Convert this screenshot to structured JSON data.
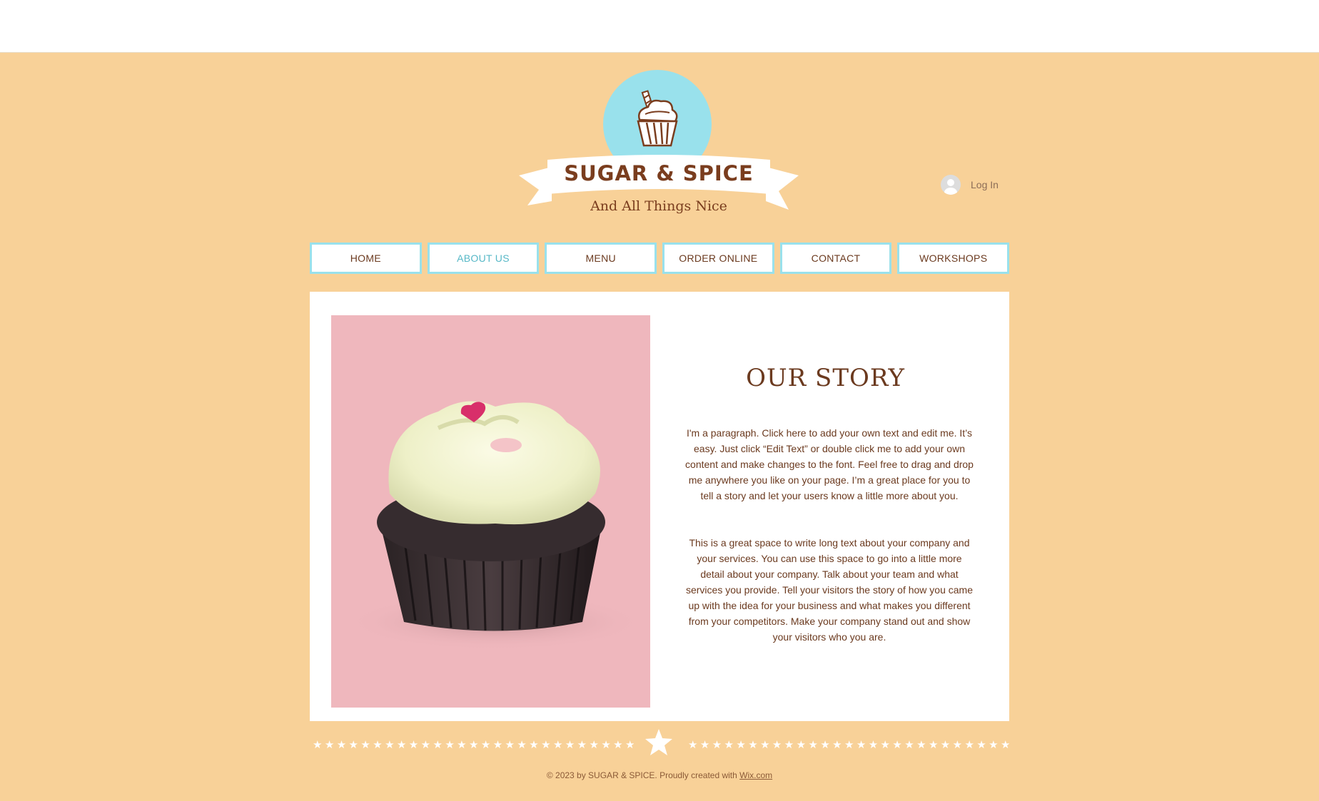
{
  "header": {
    "brand_name": "SUGAR & SPICE",
    "tagline": "And All Things Nice",
    "login_label": "Log In",
    "logo_icon": "cupcake-icon"
  },
  "nav": {
    "items": [
      {
        "label": "HOME"
      },
      {
        "label": "ABOUT US",
        "active": true
      },
      {
        "label": "MENU"
      },
      {
        "label": "ORDER ONLINE"
      },
      {
        "label": "CONTACT"
      },
      {
        "label": "WORKSHOPS"
      }
    ]
  },
  "story": {
    "title": "OUR STORY",
    "paragraph1": "I'm a paragraph. Click here to add your own text and edit me. It’s easy. Just click “Edit Text” or double click me to add your own content and make changes to the font. Feel free to drag and drop me anywhere you like on your page. I’m a great place for you to tell a story and let your users know a little more about you.",
    "paragraph2": "This is a great space to write long text about your company and your services. You can use this space to go into a little more detail about your company. Talk about your team and what services you provide. Tell your visitors the story of how you came up with the idea for your business and what makes you different from your competitors. Make your company stand out and show your visitors who you are."
  },
  "footer": {
    "copyright": "© 2023 by SUGAR & SPICE. Proudly created with ",
    "link_label": "Wix.com"
  },
  "colors": {
    "page_bg": "#f8d198",
    "accent_blue": "#99e1ec",
    "brand_brown": "#7a3d1e",
    "photo_pink": "#efb7bd"
  }
}
